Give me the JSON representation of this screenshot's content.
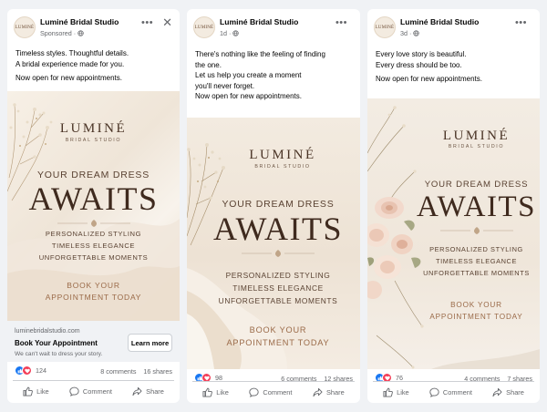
{
  "posts": [
    {
      "page_name": "Luminé Bridal Studio",
      "meta": "Sponsored · ",
      "avatar_text": "LUMINÉ",
      "caption": [
        "Timeless styles. Thoughtful details.",
        "A bridal experience made for you.",
        "",
        "Now open for new appointments."
      ],
      "creative": {
        "brand": "LUMINÉ",
        "brand_sub": "BRIDAL STUDIO",
        "kicker": "YOUR DREAM DRESS",
        "headline": "AWAITS",
        "benefits": [
          "PERSONALIZED STYLING",
          "TIMELESS ELEGANCE",
          "UNFORGETTABLE MOMENTS"
        ],
        "cta_lines": [
          "BOOK YOUR",
          "APPOINTMENT TODAY"
        ]
      },
      "link": {
        "domain": "luminebridalstudio.com",
        "title": "Book Your Appointment",
        "description": "We can't wait to dress your story.",
        "button": "Learn more"
      },
      "stats": {
        "reactions": "124",
        "comments": "8 comments",
        "shares": "16 shares"
      }
    },
    {
      "page_name": "Luminé Bridal Studio",
      "meta": "1d · ",
      "avatar_text": "LUMINÉ",
      "caption": [
        "There's nothing like the feeling of finding",
        "the one.",
        "Let us help you create a moment",
        "you'll never forget.",
        "Now open for new appointments."
      ],
      "creative": {
        "brand": "LUMINÉ",
        "brand_sub": "BRIDAL STUDIO",
        "kicker": "YOUR DREAM DRESS",
        "headline": "AWAITS",
        "benefits": [
          "PERSONALIZED STYLING",
          "TIMELESS ELEGANCE",
          "UNFORGETTABLE MOMENTS"
        ],
        "cta_lines": [
          "BOOK YOUR",
          "APPOINTMENT TODAY"
        ]
      },
      "stats": {
        "reactions": "98",
        "comments": "6 comments",
        "shares": "12 shares"
      }
    },
    {
      "page_name": "Luminé Bridal Studio",
      "meta": "3d · ",
      "avatar_text": "LUMINÉ",
      "caption": [
        "Every love story is beautiful.",
        "Every dress should be too.",
        "",
        "Now open for new appointments."
      ],
      "creative": {
        "brand": "LUMINÉ",
        "brand_sub": "BRIDAL STUDIO",
        "kicker": "YOUR DREAM DRESS",
        "headline": "AWAITS",
        "benefits": [
          "PERSONALIZED STYLING",
          "TIMELESS ELEGANCE",
          "UNFORGETTABLE MOMENTS"
        ],
        "cta_lines": [
          "BOOK YOUR",
          "APPOINTMENT TODAY"
        ]
      },
      "stats": {
        "reactions": "76",
        "comments": "4 comments",
        "shares": "7 shares"
      }
    }
  ],
  "actions": {
    "like": "Like",
    "comment": "Comment",
    "share": "Share"
  },
  "icons": {
    "more": "more-options-icon",
    "close": "close-icon",
    "globe": "globe-icon",
    "like_reaction": "like-reaction-icon",
    "love_reaction": "love-reaction-icon"
  },
  "colors": {
    "facebook_blue": "#1877f2",
    "love_red": "#f33e58",
    "brand_brown": "#3f2a1e",
    "cta_tan": "#9a6a48"
  }
}
